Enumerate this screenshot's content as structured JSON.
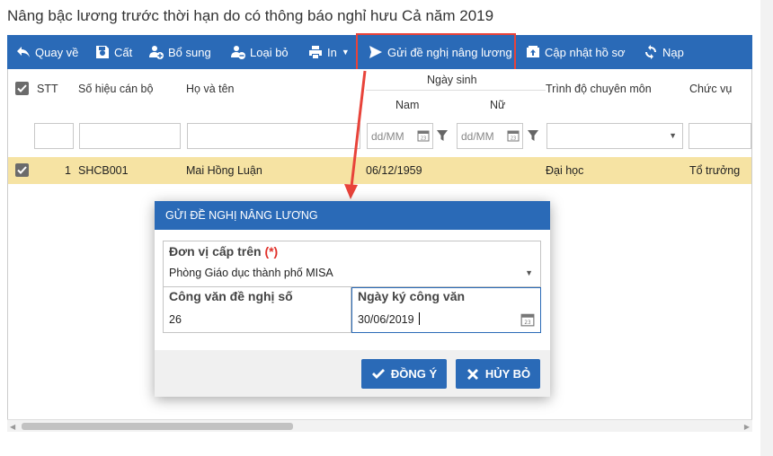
{
  "window": {
    "title": "Nâng bậc lương trước thời hạn do có thông báo nghỉ hưu Cả năm 2019"
  },
  "toolbar": {
    "items": [
      {
        "label": "Quay về",
        "icon": "back-icon"
      },
      {
        "label": "Cất",
        "icon": "save-icon"
      },
      {
        "label": "Bổ sung",
        "icon": "add-user-icon"
      },
      {
        "label": "Loại bỏ",
        "icon": "remove-user-icon"
      },
      {
        "label": "In",
        "icon": "print-icon"
      },
      {
        "label": "Gửi đề nghị nâng lương",
        "icon": "send-icon"
      },
      {
        "label": "Cập nhật hồ sơ",
        "icon": "update-record-icon"
      },
      {
        "label": "Nạp",
        "icon": "refresh-icon"
      }
    ],
    "highlight_color": "#e8433a"
  },
  "grid": {
    "headers": {
      "stt": "STT",
      "code": "Số hiệu cán bộ",
      "name": "Họ và tên",
      "dob": "Ngày sinh",
      "male": "Nam",
      "female": "Nữ",
      "education": "Trình độ chuyên môn",
      "position": "Chức vụ"
    },
    "filters": {
      "date_placeholder": "dd/MM"
    },
    "rows": [
      {
        "stt": "1",
        "code": "SHCB001",
        "name": "Mai Hồng Luận",
        "dob": "06/12/1959",
        "education": "Đại học",
        "position": "Tổ trưởng",
        "selected": true
      }
    ],
    "selected_row_color": "#f6e3a3"
  },
  "dialog": {
    "title": "GỬI ĐỀ NGHỊ NÂNG LƯƠNG",
    "unit_label": "Đơn vị cấp trên",
    "required_mark": "(*)",
    "unit_value": "Phòng Giáo dục thành phố MISA",
    "doc_no_label": "Công văn đề nghị số",
    "doc_no_value": "26",
    "doc_date_label": "Ngày ký công văn",
    "doc_date_value": "30/06/2019",
    "ok_label": "ĐỒNG Ý",
    "cancel_label": "HỦY BỎ"
  },
  "colors": {
    "primary": "#2a6ab7",
    "annotation": "#e8433a"
  }
}
